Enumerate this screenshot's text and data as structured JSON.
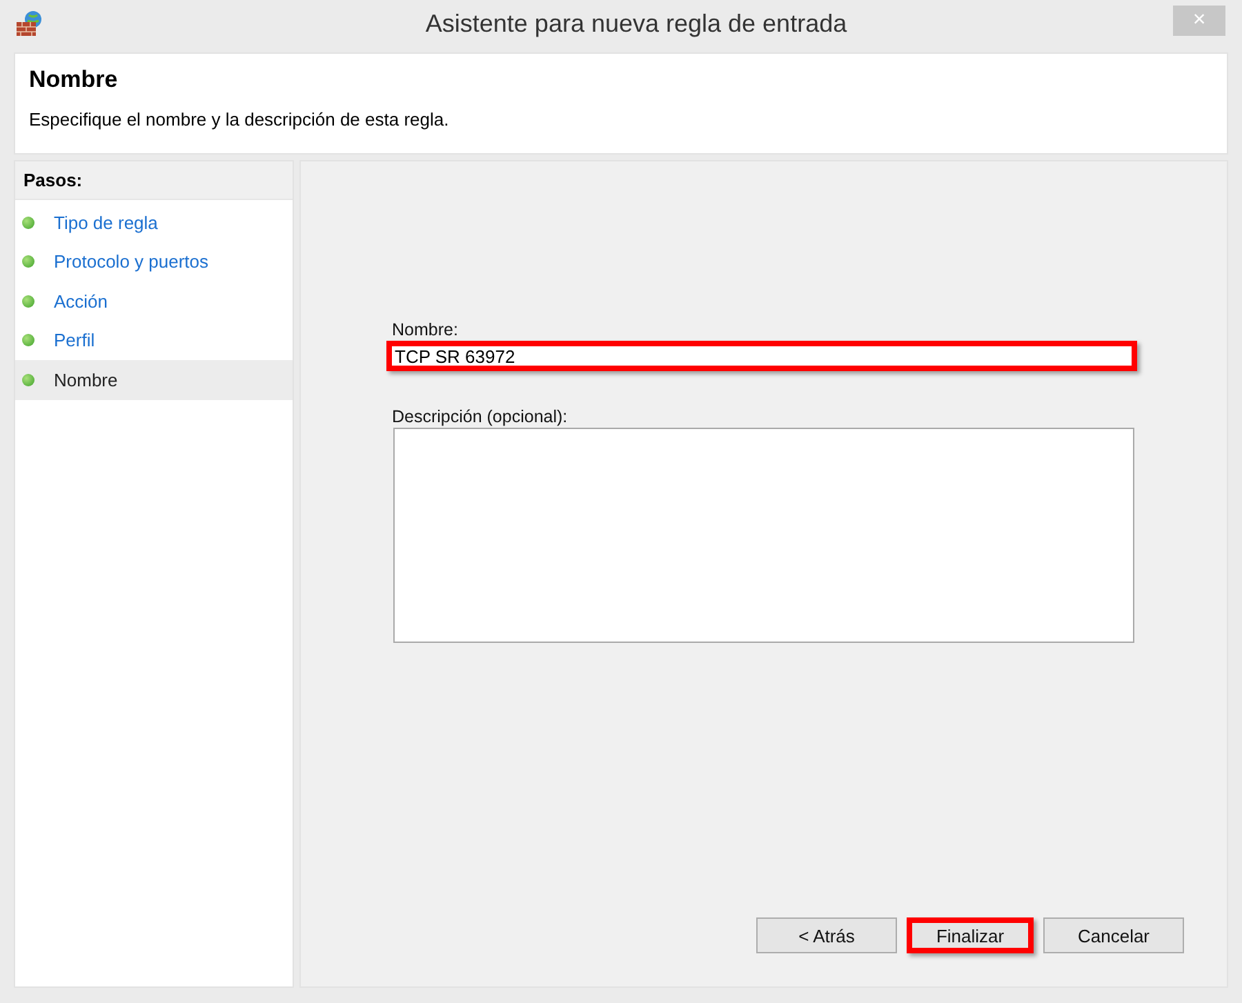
{
  "window": {
    "title": "Asistente para nueva regla de entrada",
    "close": "×"
  },
  "header": {
    "title": "Nombre",
    "description": "Especifique el nombre y la descripción de esta regla."
  },
  "steps": {
    "heading": "Pasos:",
    "items": [
      {
        "label": "Tipo de regla",
        "selected": false
      },
      {
        "label": "Protocolo y puertos",
        "selected": false
      },
      {
        "label": "Acción",
        "selected": false
      },
      {
        "label": "Perfil",
        "selected": false
      },
      {
        "label": "Nombre",
        "selected": true
      }
    ]
  },
  "form": {
    "name_label": "Nombre:",
    "name_value": "TCP SR 63972",
    "name_highlighted": true,
    "description_label": "Descripción (opcional):"
  },
  "buttons": [
    {
      "label": "< Atrás",
      "highlighted": false
    },
    {
      "label": "Finalizar",
      "highlighted": true
    },
    {
      "label": "Cancelar",
      "highlighted": false
    }
  ]
}
